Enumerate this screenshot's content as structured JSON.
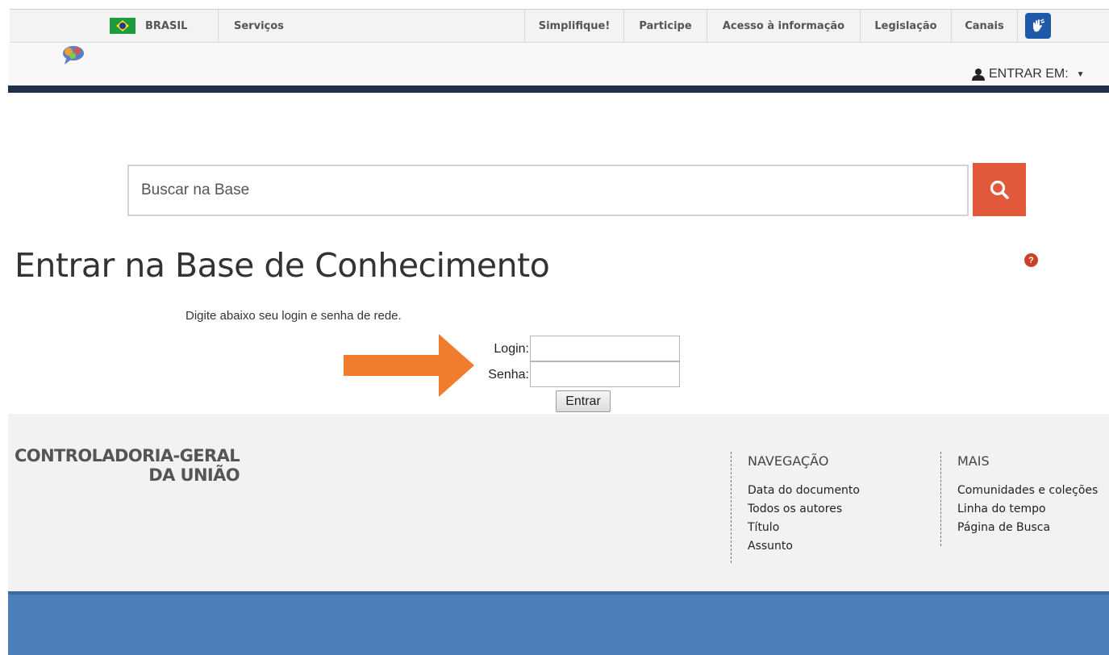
{
  "gov_bar": {
    "brand": "BRASIL",
    "services": "Serviços",
    "items": [
      "Simplifique!",
      "Participe",
      "Acesso à informação",
      "Legislação",
      "Canais"
    ],
    "accessibility_icon": "libras-hands-icon"
  },
  "header": {
    "login_menu": "ENTRAR EM:"
  },
  "search": {
    "placeholder": "Buscar na Base"
  },
  "page": {
    "title": "Entrar na Base de Conhecimento",
    "help_icon_label": "?"
  },
  "login_form": {
    "instructions": "Digite abaixo seu login e senha de rede.",
    "login_label": "Login:",
    "password_label": "Senha:",
    "login_value": "",
    "password_value": "",
    "submit_label": "Entrar",
    "arrow_color": "#f07c2e"
  },
  "footer": {
    "org_line1": "CONTROLADORIA-GERAL",
    "org_line2": "DA UNIÃO",
    "columns": [
      {
        "title": "NAVEGAÇÃO",
        "links": [
          "Data do documento",
          "Todos os autores",
          "Título",
          "Assunto"
        ]
      },
      {
        "title": "MAIS",
        "links": [
          "Comunidades e coleções",
          "Linha do tempo",
          "Página de Busca"
        ]
      }
    ]
  },
  "colors": {
    "search_button": "#e2583a",
    "header_bar": "#232f46",
    "footer_band": "#4b7ebb"
  }
}
